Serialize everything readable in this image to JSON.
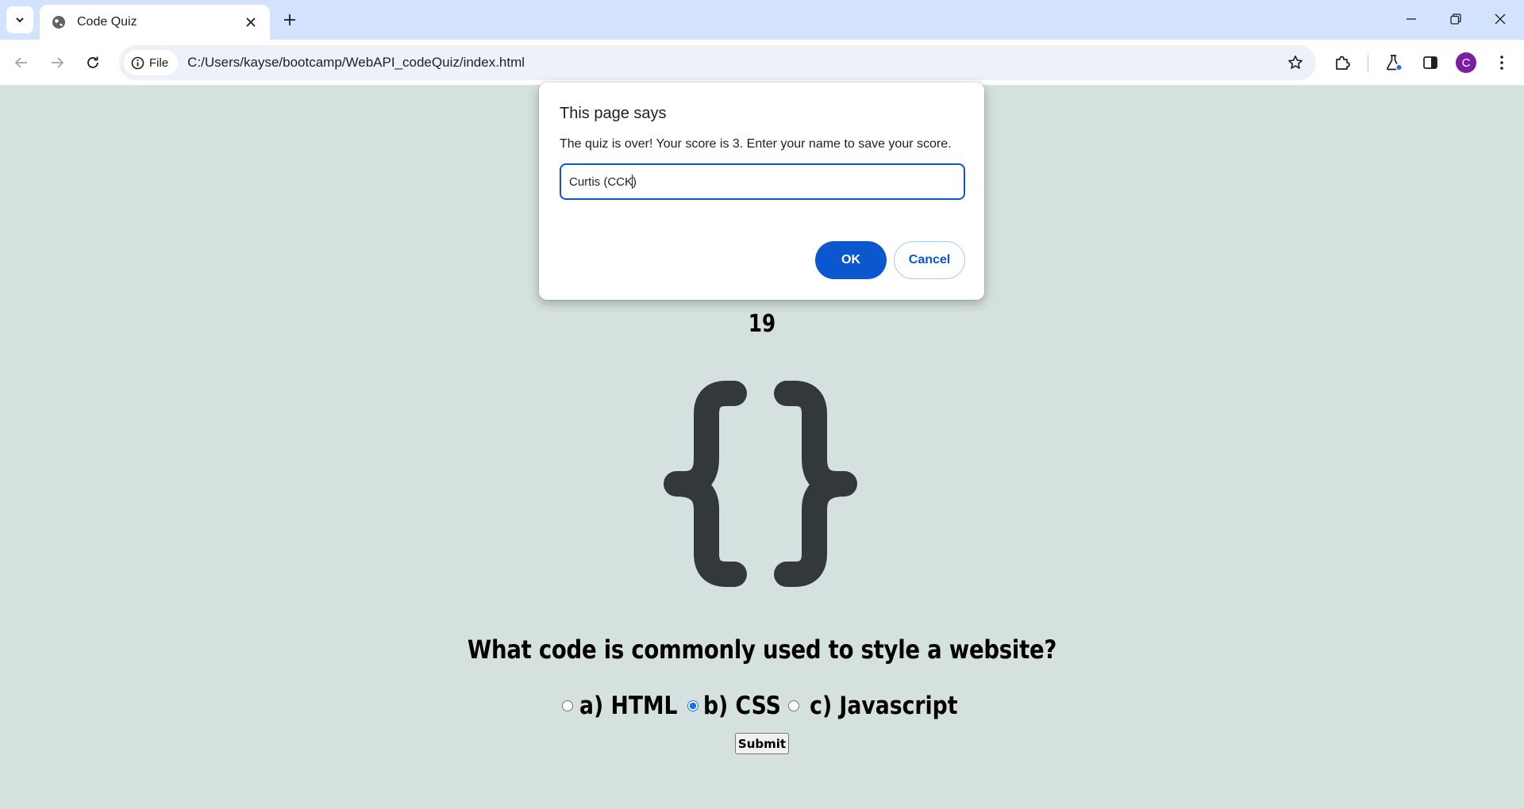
{
  "browser": {
    "tab_title": "Code Quiz",
    "file_chip": "File",
    "url": "C:/Users/kayse/bootcamp/WebAPI_codeQuiz/index.html",
    "profile_initial": "C",
    "profile_color": "#7b1fa2",
    "icons": [
      "tab-search-icon",
      "globe-icon",
      "close-icon",
      "plus-icon",
      "minimize-icon",
      "restore-icon",
      "back-icon",
      "forward-icon",
      "reload-icon",
      "info-icon",
      "star-icon",
      "extensions-icon",
      "labs-flask-icon",
      "side-panel-icon",
      "kebab-menu-icon"
    ]
  },
  "page": {
    "timer": "19",
    "logo": "curly-braces-icon",
    "question": "What code is commonly used to style a website?",
    "answers": [
      {
        "label": "a) HTML",
        "checked": false
      },
      {
        "label": "b) CSS",
        "checked": true
      },
      {
        "label": "c) Javascript",
        "checked": false
      }
    ],
    "submit_label": "Submit"
  },
  "dialog": {
    "title": "This page says",
    "message": "The quiz is over! Your score is 3. Enter your name to save your score.",
    "input_value": "Curtis (CCK)",
    "ok_label": "OK",
    "cancel_label": "Cancel"
  },
  "colors": {
    "page_bg": "#d5e1df",
    "tabstrip_bg": "#d3e3fd",
    "accent": "#0b57d0",
    "logo": "#33393a"
  }
}
